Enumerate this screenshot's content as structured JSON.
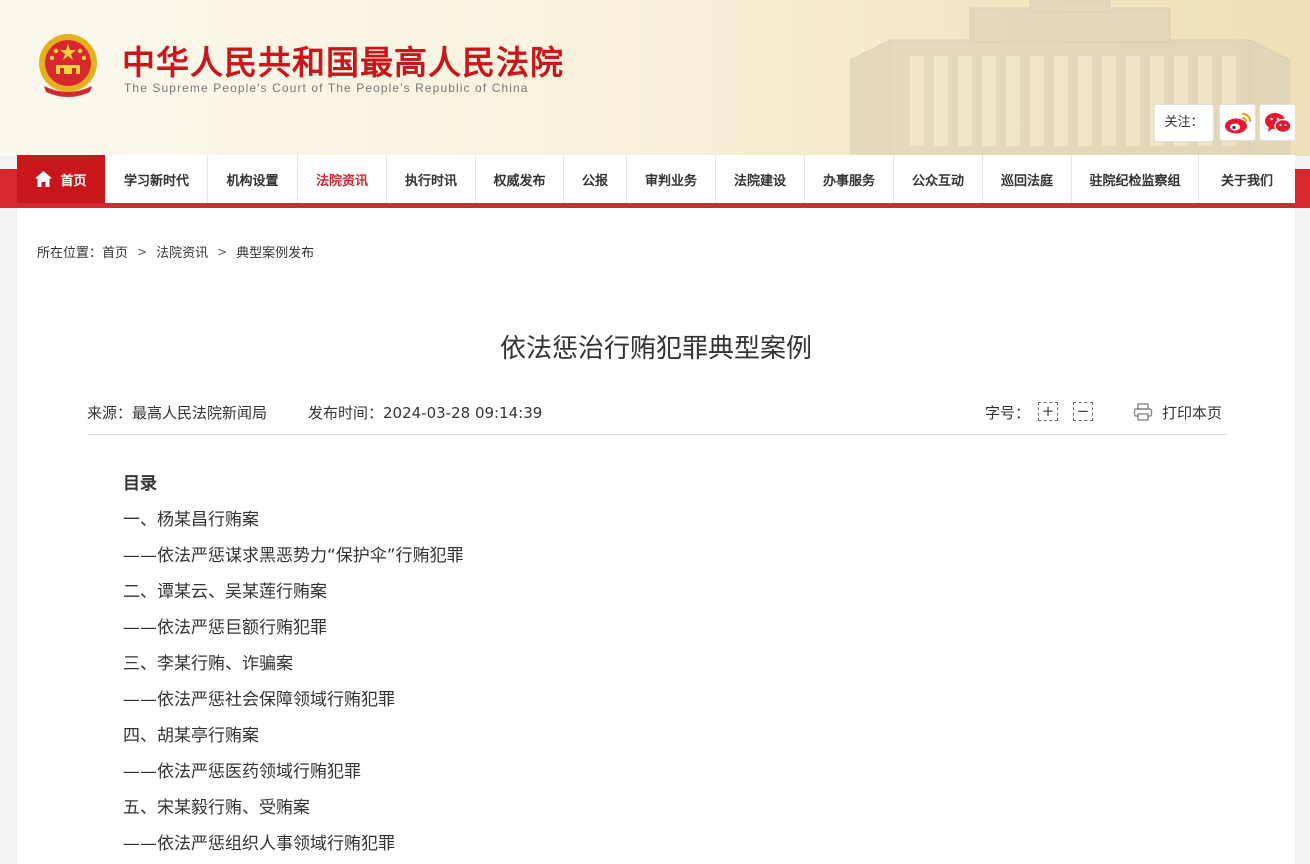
{
  "header": {
    "site_title": "中华人民共和国最高人民法院",
    "site_subtitle": "The Supreme People's Court of The People's Republic of China",
    "follow_label": "关注：",
    "social": [
      "weibo-icon",
      "wechat-icon"
    ]
  },
  "nav": {
    "items": [
      {
        "label": "首页"
      },
      {
        "label": "学习新时代"
      },
      {
        "label": "机构设置"
      },
      {
        "label": "法院资讯"
      },
      {
        "label": "执行时讯"
      },
      {
        "label": "权威发布"
      },
      {
        "label": "公报"
      },
      {
        "label": "审判业务"
      },
      {
        "label": "法院建设"
      },
      {
        "label": "办事服务"
      },
      {
        "label": "公众互动"
      },
      {
        "label": "巡回法庭"
      },
      {
        "label": "驻院纪检监察组"
      },
      {
        "label": "关于我们"
      }
    ],
    "active_index": 3
  },
  "breadcrumb": {
    "prefix": "所在位置：",
    "items": [
      "首页",
      "法院资讯",
      "典型案例发布"
    ]
  },
  "article": {
    "title": "依法惩治行贿犯罪典型案例",
    "source": "来源：最高人民法院新闻局",
    "publish_time": "发布时间：2024-03-28 09:14:39",
    "font_size_label": "字号：",
    "font_plus": "+",
    "font_minus": "−",
    "print_label": "打印本页"
  },
  "toc": {
    "heading": "目录",
    "lines": [
      "一、杨某昌行贿案",
      "——依法严惩谋求黑恶势力“保护伞”行贿犯罪",
      "二、谭某云、吴某莲行贿案",
      "——依法严惩巨额行贿犯罪",
      "三、李某行贿、诈骗案",
      "——依法严惩社会保障领域行贿犯罪",
      "四、胡某亭行贿案",
      "——依法严惩医药领域行贿犯罪",
      "五、宋某毅行贿、受贿案",
      "——依法严惩组织人事领域行贿犯罪"
    ]
  },
  "colors": {
    "brand_red": "#c8161d",
    "nav_red": "#d7282f",
    "header_bg": "#f8f1dc"
  }
}
